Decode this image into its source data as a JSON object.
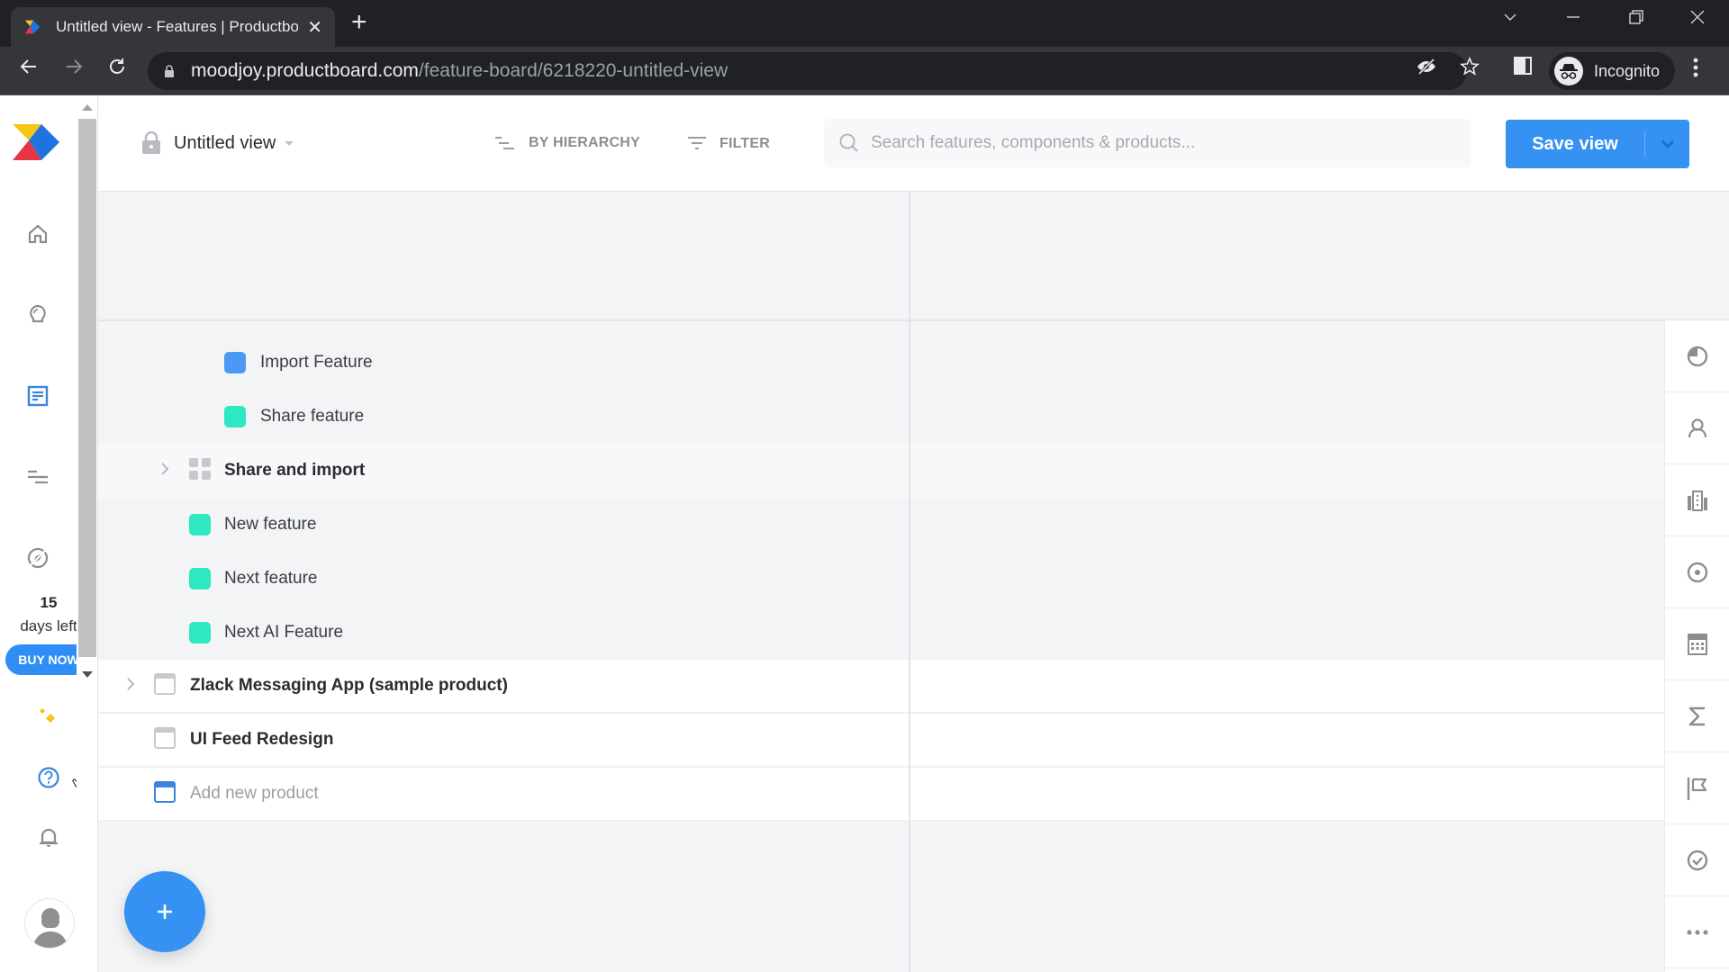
{
  "browser": {
    "tab_title": "Untitled view - Features | Productboard",
    "new_tab_icon": "plus-icon",
    "url_host": "moodjoy.productboard.com",
    "url_path": "/feature-board/6218220-untitled-view",
    "profile_label": "Incognito",
    "window_controls": [
      "tab-search",
      "minimize",
      "restore",
      "close"
    ]
  },
  "rail": {
    "items": [
      {
        "name": "home",
        "icon": "home-icon"
      },
      {
        "name": "insights",
        "icon": "lightbulb-icon"
      },
      {
        "name": "features",
        "icon": "document-icon",
        "active": true
      },
      {
        "name": "roadmaps",
        "icon": "roadmap-icon"
      },
      {
        "name": "portal",
        "icon": "compass-icon"
      }
    ],
    "trial_days": "15",
    "trial_text": "days left",
    "buy_now": "BUY NOW",
    "bottom_items": [
      {
        "name": "whats-new",
        "icon": "sparkle-icon"
      },
      {
        "name": "help",
        "icon": "help-icon"
      },
      {
        "name": "notifications",
        "icon": "bell-icon"
      }
    ]
  },
  "header": {
    "view_title": "Untitled view",
    "group_by": "BY HIERARCHY",
    "filter": "FILTER",
    "search_placeholder": "Search features, components & products...",
    "save_view": "Save view"
  },
  "board": {
    "rows": [
      {
        "label": "Import Feature",
        "type": "feature",
        "color": "#4a9af5",
        "level": 3,
        "expandable": false
      },
      {
        "label": "Share feature",
        "type": "feature",
        "color": "#2ee8c2",
        "level": 3,
        "expandable": false
      },
      {
        "label": "Share and import",
        "type": "component",
        "level": 2,
        "expandable": true,
        "bold": true,
        "highlighted": true
      },
      {
        "label": "New feature",
        "type": "feature",
        "color": "#2ee8c2",
        "level": 2,
        "expandable": false
      },
      {
        "label": "Next feature",
        "type": "feature",
        "color": "#2ee8c2",
        "level": 2,
        "expandable": false
      },
      {
        "label": "Next AI Feature",
        "type": "feature",
        "color": "#2ee8c2",
        "level": 2,
        "expandable": false
      },
      {
        "label": "Zlack Messaging App (sample product)",
        "type": "product",
        "level": 1,
        "expandable": true,
        "bold": true
      },
      {
        "label": "UI Feed Redesign",
        "type": "product",
        "level": 1,
        "expandable": false,
        "bold": true
      },
      {
        "label": "Add new product",
        "type": "add-product",
        "level": 1,
        "expandable": false,
        "muted": true
      }
    ]
  },
  "right_panel": {
    "icons": [
      "progress-icon",
      "user-icon",
      "company-icon",
      "target-icon",
      "calculator-icon",
      "sigma-icon",
      "flag-icon",
      "check-circle-icon",
      "more-icon"
    ]
  },
  "colors": {
    "accent": "#3591f2",
    "feature_teal": "#2ee8c2",
    "feature_blue": "#4a9af5"
  }
}
